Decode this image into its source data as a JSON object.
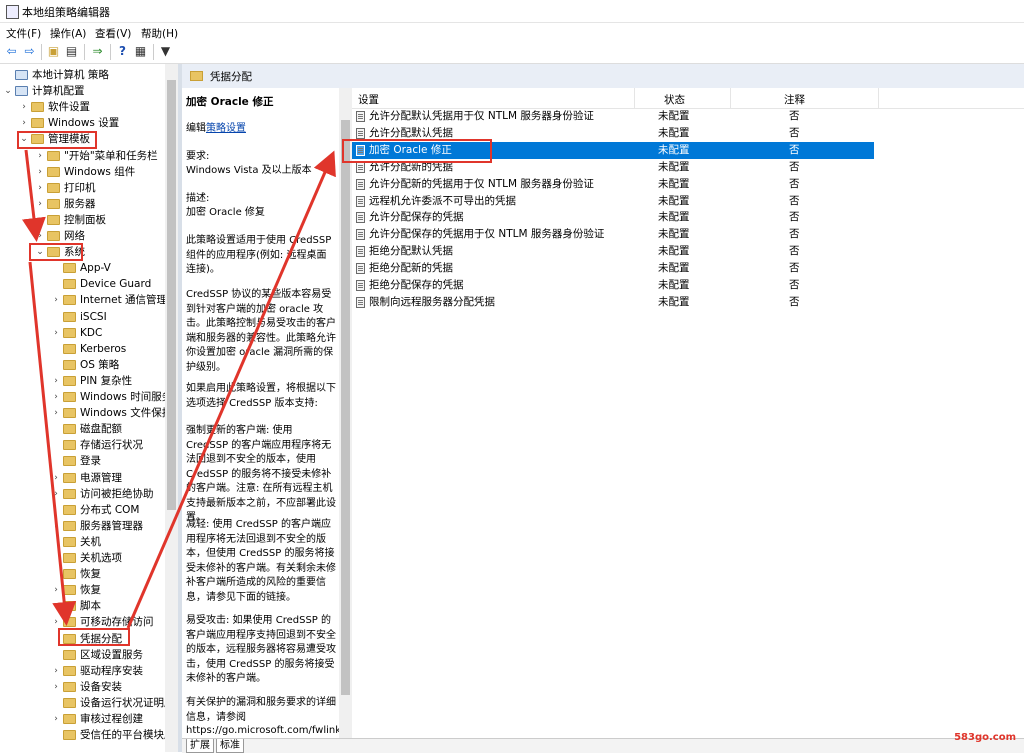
{
  "window": {
    "title": "本地组策略编辑器"
  },
  "menu": [
    "文件(F)",
    "操作(A)",
    "查看(V)",
    "帮助(H)"
  ],
  "toolbar_icons": [
    "back-icon",
    "forward-icon",
    "up-folder-icon",
    "show-hide-tree-icon",
    "export-list-icon",
    "help-icon",
    "properties-icon",
    "filter-icon"
  ],
  "tree": {
    "root": "本地计算机 策略",
    "computer_config": "计算机配置",
    "software_settings": "软件设置",
    "windows_settings": "Windows 设置",
    "admin_templates": "管理模板",
    "admin_children": [
      "\"开始\"菜单和任务栏",
      "Windows 组件",
      "打印机",
      "服务器",
      "控制面板",
      "网络",
      "系统"
    ],
    "system_children": [
      "App-V",
      "Device Guard",
      "Internet 通信管理",
      "iSCSI",
      "KDC",
      "Kerberos",
      "OS 策略",
      "PIN 复杂性",
      "Windows 时间服务",
      "Windows 文件保护",
      "磁盘配额",
      "存储运行状况",
      "登录",
      "电源管理",
      "访问被拒绝协助",
      "分布式 COM",
      "服务器管理器",
      "关机",
      "关机选项",
      "恢复",
      "恢复",
      "脚本",
      "可移动存储访问",
      "凭据分配",
      "区域设置服务",
      "驱动程序安装",
      "设备安装",
      "设备运行状况证明服务",
      "审核过程创建",
      "受信任的平台模块服务"
    ]
  },
  "right_header": "凭据分配",
  "description": {
    "title": "加密 Oracle 修正",
    "edit_prefix": "编辑",
    "edit_link": "策略设置",
    "req_label": "要求:",
    "req_value": "Windows Vista 及以上版本",
    "desc_label": "描述:",
    "desc_value": "加密 Oracle 修复",
    "p1": "此策略设置适用于使用 CredSSP 组件的应用程序(例如: 远程桌面连接)。",
    "p2": "CredSSP 协议的某些版本容易受到针对客户端的加密 oracle 攻击。此策略控制与易受攻击的客户端和服务器的兼容性。此策略允许你设置加密 oracle 漏洞所需的保护级别。",
    "p3": "如果启用此策略设置，将根据以下选项选择 CredSSP 版本支持:",
    "p4": "强制更新的客户端: 使用 CredSSP 的客户端应用程序将无法回退到不安全的版本，使用 CredSSP 的服务将不接受未修补的客户端。注意: 在所有远程主机支持最新版本之前，不应部署此设置。",
    "p5": "减轻: 使用 CredSSP 的客户端应用程序将无法回退到不安全的版本，但使用 CredSSP 的服务将接受未修补的客户端。有关剩余未修补客户端所造成的风险的重要信息，请参见下面的链接。",
    "p6": "易受攻击: 如果使用 CredSSP 的客户端应用程序支持回退到不安全的版本，远程服务器将容易遭受攻击，使用 CredSSP 的服务将接受未修补的客户端。",
    "p7": "有关保护的漏洞和服务要求的详细信息，请参阅",
    "p7_link": "https://go.microsoft.com/fwlink"
  },
  "list": {
    "headers": {
      "setting": "设置",
      "state": "状态",
      "comment": "注释"
    },
    "rows": [
      {
        "name": "允许分配默认凭据用于仅 NTLM 服务器身份验证",
        "state": "未配置",
        "comment": "否"
      },
      {
        "name": "允许分配默认凭据",
        "state": "未配置",
        "comment": "否"
      },
      {
        "name": "加密 Oracle 修正",
        "state": "未配置",
        "comment": "否"
      },
      {
        "name": "允许分配新的凭据",
        "state": "未配置",
        "comment": "否"
      },
      {
        "name": "允许分配新的凭据用于仅 NTLM 服务器身份验证",
        "state": "未配置",
        "comment": "否"
      },
      {
        "name": "远程机允许委派不可导出的凭据",
        "state": "未配置",
        "comment": "否"
      },
      {
        "name": "允许分配保存的凭据",
        "state": "未配置",
        "comment": "否"
      },
      {
        "name": "允许分配保存的凭据用于仅 NTLM 服务器身份验证",
        "state": "未配置",
        "comment": "否"
      },
      {
        "name": "拒绝分配默认凭据",
        "state": "未配置",
        "comment": "否"
      },
      {
        "name": "拒绝分配新的凭据",
        "state": "未配置",
        "comment": "否"
      },
      {
        "name": "拒绝分配保存的凭据",
        "state": "未配置",
        "comment": "否"
      },
      {
        "name": "限制向远程服务器分配凭据",
        "state": "未配置",
        "comment": "否"
      }
    ]
  },
  "tabs": [
    "扩展",
    "标准"
  ],
  "watermark": "583go.com",
  "colors": {
    "annotation": "#e0352b",
    "selection": "#0078d7"
  }
}
